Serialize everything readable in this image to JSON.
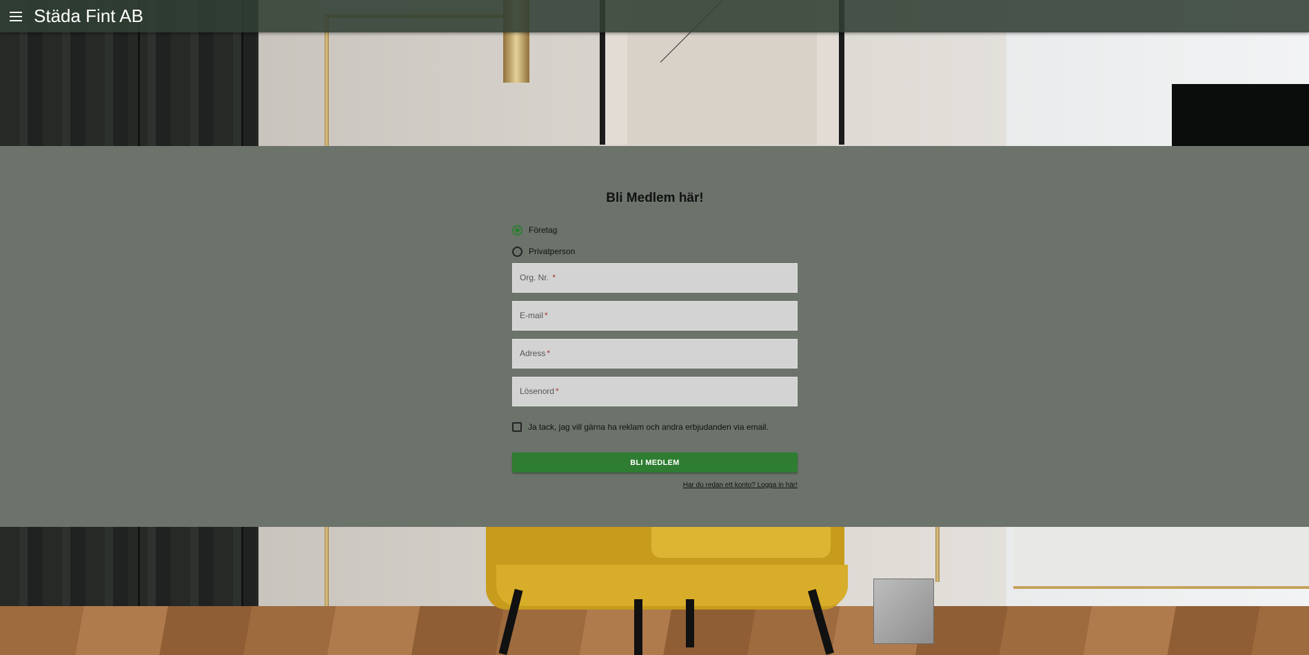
{
  "app": {
    "title": "Städa Fint AB"
  },
  "form": {
    "title": "Bli Medlem här!",
    "account_types": [
      {
        "label": "Företag",
        "selected": true
      },
      {
        "label": "Privatperson",
        "selected": false
      }
    ],
    "fields": [
      {
        "label": "Org. Nr.",
        "required_mark": "*",
        "value": ""
      },
      {
        "label": "E-mail",
        "required_mark": "*",
        "value": ""
      },
      {
        "label": "Adress",
        "required_mark": "*",
        "value": ""
      },
      {
        "label": "Lösenord",
        "required_mark": "*",
        "value": ""
      }
    ],
    "newsletter_label": "Ja tack, jag vill gärna ha reklam och andra erbjudanden via email.",
    "newsletter_checked": false,
    "submit_label": "BLI MEDLEM",
    "login_link": "Har du redan ett konto? Logga in här!"
  },
  "colors": {
    "appbar": "#313f33",
    "band": "#6b736b",
    "accent": "#2e7d32",
    "field_bg": "#d3d3d3"
  },
  "icons": {
    "menu": "hamburger-menu-icon"
  }
}
